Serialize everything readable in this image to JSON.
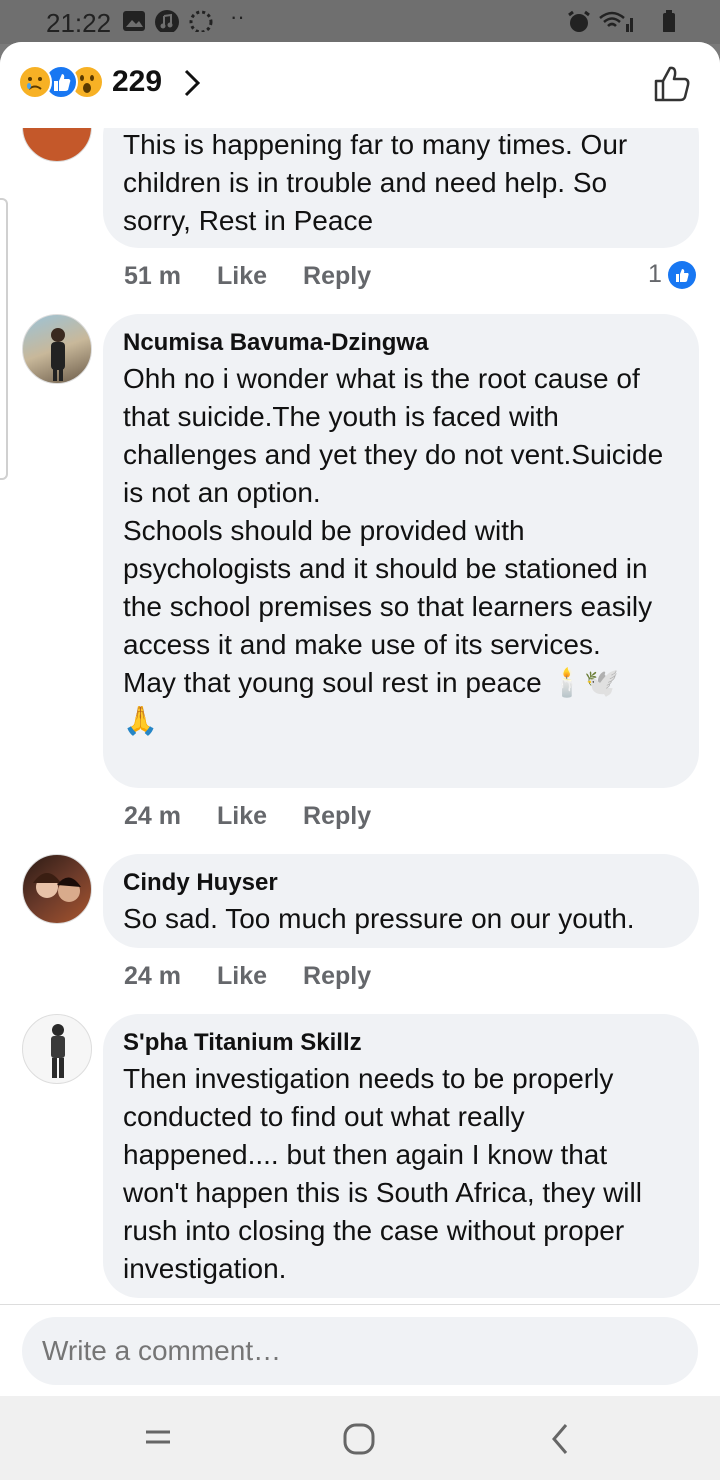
{
  "status": {
    "time": "21:22"
  },
  "header": {
    "reaction_count": "229"
  },
  "comments": [
    {
      "author": "",
      "text": "This is happening far to many times. Our children is in trouble and need help. So sorry, Rest in Peace",
      "time": "51 m",
      "like": "Like",
      "reply": "Reply",
      "likes": "1"
    },
    {
      "author": "Ncumisa Bavuma-Dzingwa",
      "text": "Ohh no i wonder what is the root cause of that suicide.The youth is faced with challenges and yet they do not vent.Suicide is not an option.\nSchools should be provided with psychologists and it should be stationed in the school premises so that learners easily access it and make use of its services.\nMay that young soul rest in peace 🕯️🕊️\n🙏",
      "time": "24 m",
      "like": "Like",
      "reply": "Reply"
    },
    {
      "author": "Cindy Huyser",
      "text": "So sad. Too much pressure on our youth.",
      "time": "24 m",
      "like": "Like",
      "reply": "Reply"
    },
    {
      "author": "S'pha Titanium Skillz",
      "text": "Then investigation needs to be properly conducted to find out what really happened.... but then again I know that won't happen this is South Africa, they will rush into closing the case without proper investigation."
    }
  ],
  "composer": {
    "placeholder": "Write a comment…"
  },
  "colors": {
    "accent": "#1877f2",
    "bubble": "#f0f2f5",
    "meta": "#65676b"
  }
}
